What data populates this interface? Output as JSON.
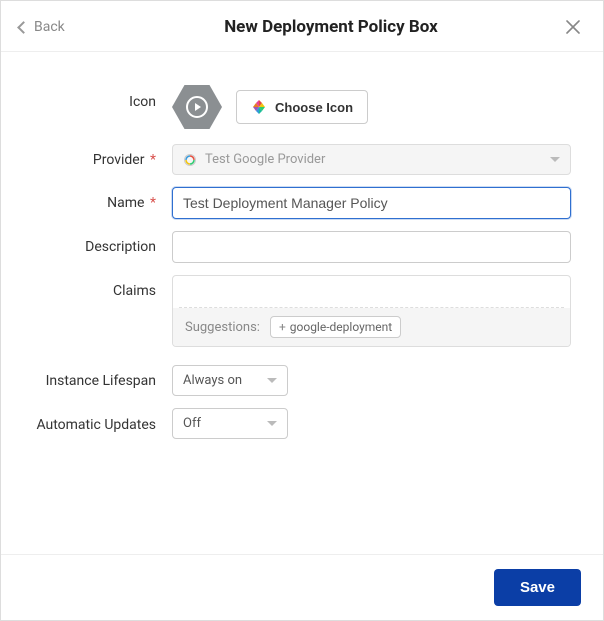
{
  "header": {
    "back_label": "Back",
    "title": "New Deployment Policy Box"
  },
  "form": {
    "icon": {
      "label": "Icon",
      "choose_label": "Choose Icon"
    },
    "provider": {
      "label": "Provider",
      "required_mark": "*",
      "value": "Test Google Provider"
    },
    "name": {
      "label": "Name",
      "required_mark": "*",
      "value": "Test Deployment Manager Policy"
    },
    "description": {
      "label": "Description",
      "value": ""
    },
    "claims": {
      "label": "Claims",
      "suggestions_label": "Suggestions:",
      "suggestion_chip": "google-deployment"
    },
    "lifespan": {
      "label": "Instance Lifespan",
      "value": "Always on"
    },
    "updates": {
      "label": "Automatic Updates",
      "value": "Off"
    }
  },
  "footer": {
    "save_label": "Save"
  }
}
